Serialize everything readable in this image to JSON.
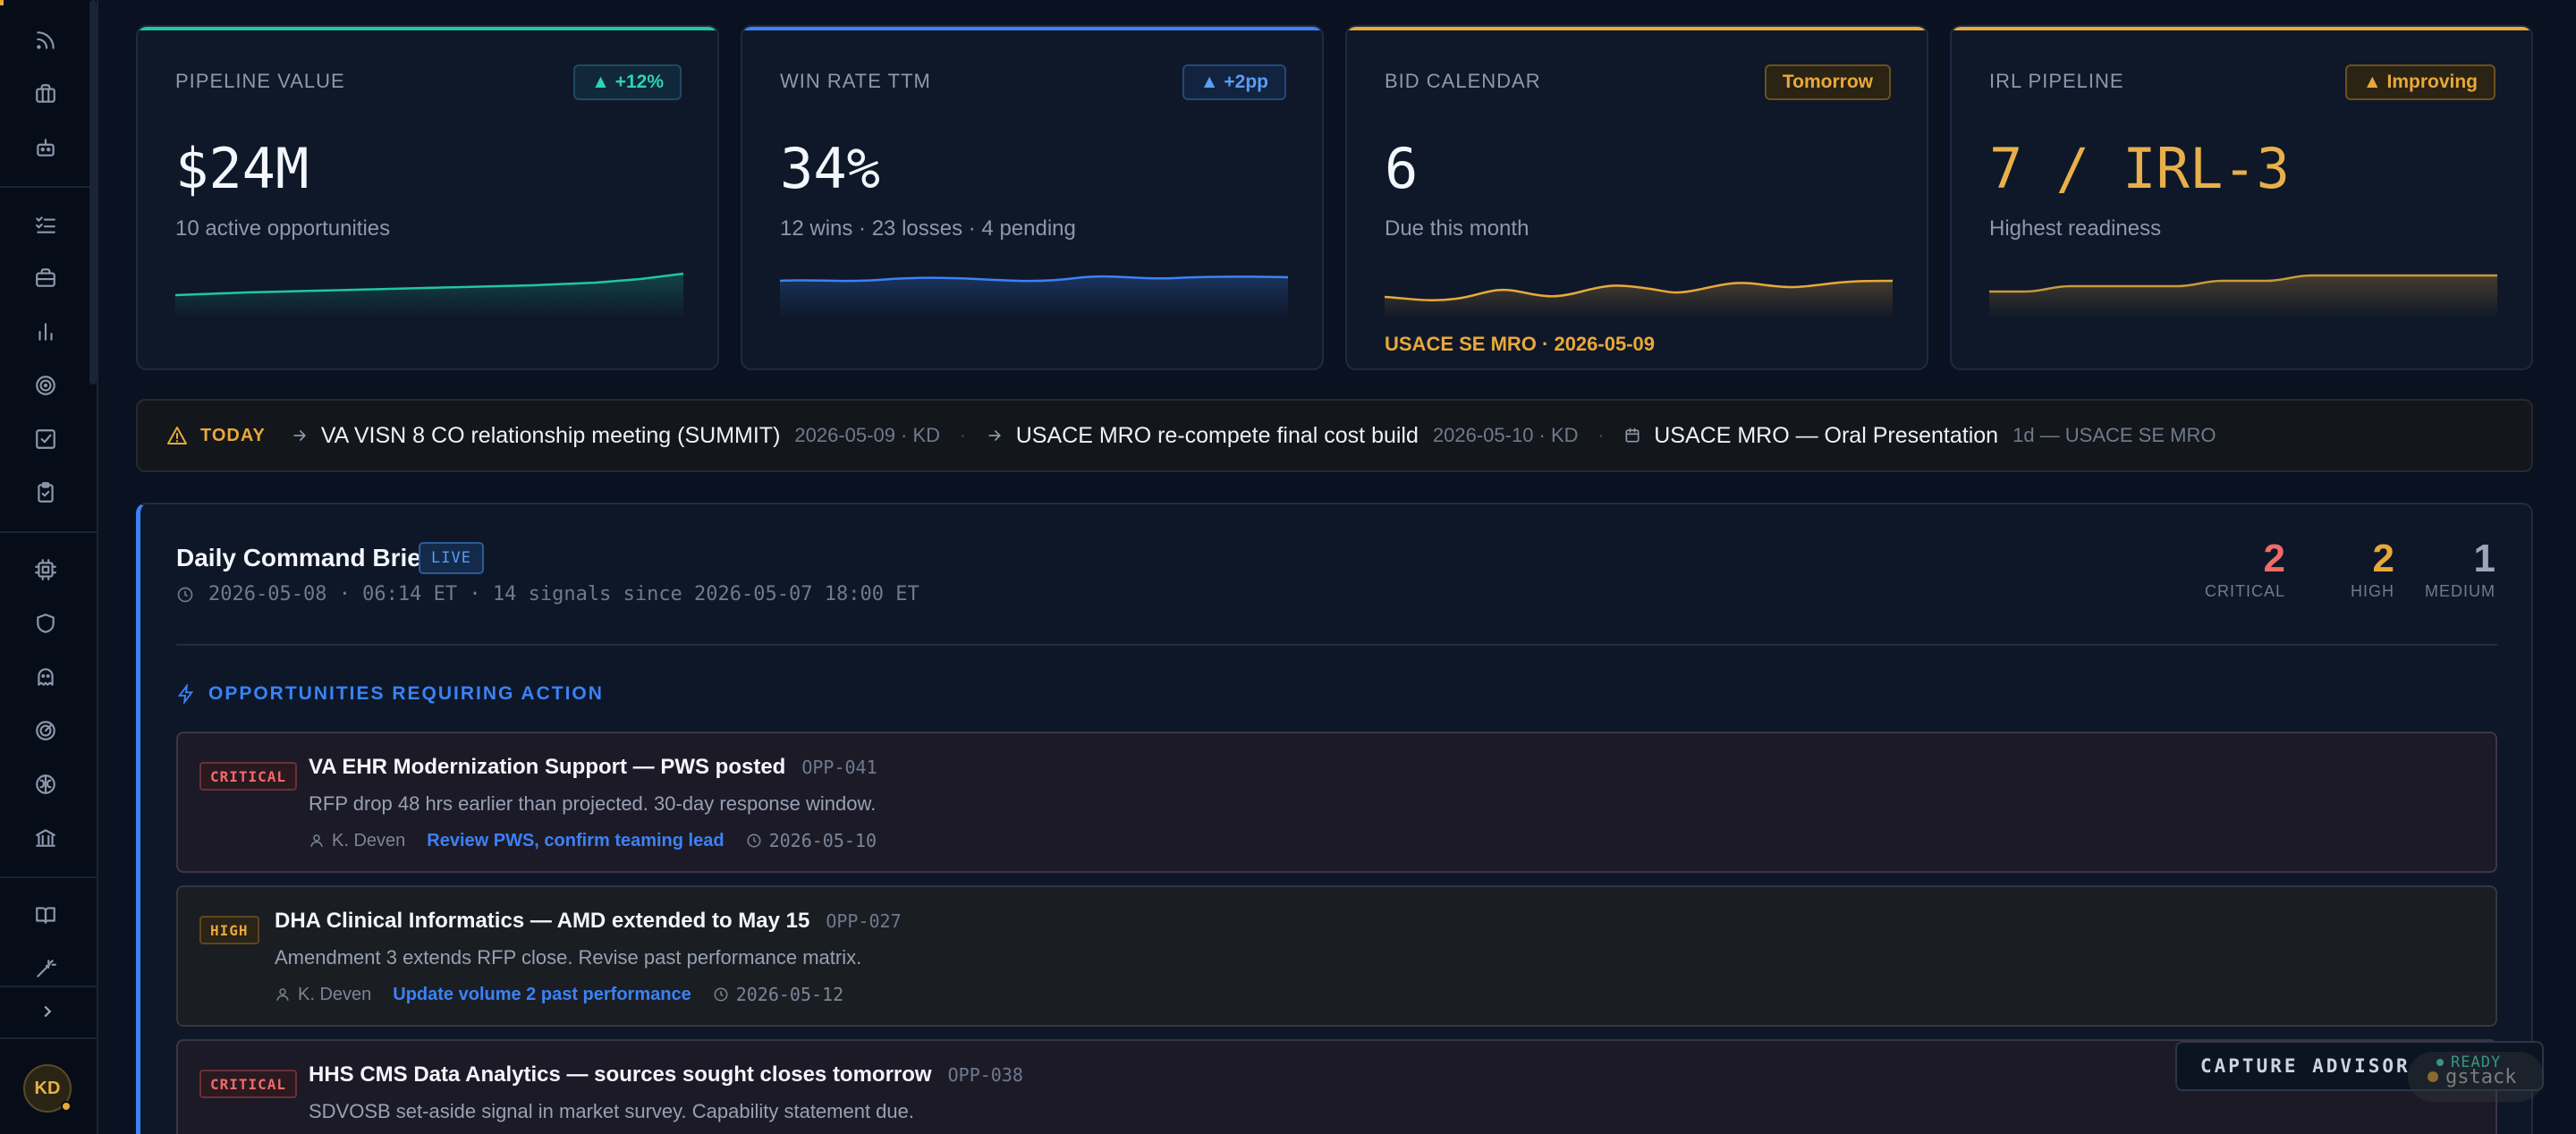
{
  "sidebar": {
    "icons": [
      "rss-icon",
      "briefcase-icon",
      "bot-icon",
      "checklist-icon",
      "briefcase-alt-icon",
      "bar-chart-icon",
      "target-icon",
      "check-square-icon",
      "clipboard-icon",
      "cpu-icon",
      "shield-icon",
      "ghost-icon",
      "radar-icon",
      "brain-icon",
      "bank-icon",
      "book-icon",
      "magic-wand-icon"
    ],
    "user_initials": "KD"
  },
  "cards": [
    {
      "label": "PIPELINE VALUE",
      "value": "$24M",
      "sub": "10 active opportunities",
      "badge": "▲ +12%",
      "accent": "#1fc7a4",
      "note": ""
    },
    {
      "label": "WIN RATE TTM",
      "value": "34%",
      "sub": "12 wins · 23 losses · 4 pending",
      "badge": "▲ +2pp",
      "accent": "#3b82f6",
      "note": ""
    },
    {
      "label": "BID CALENDAR",
      "value": "6",
      "sub": "Due this month",
      "badge": "Tomorrow",
      "accent": "#e8a93a",
      "note": "USACE SE MRO · 2026-05-09"
    },
    {
      "label": "IRL PIPELINE",
      "value": "7 / IRL-3",
      "sub": "Highest readiness",
      "badge": "▲ Improving",
      "accent": "#e8a93a",
      "note": ""
    }
  ],
  "today": {
    "label": "TODAY",
    "items": [
      {
        "title": "VA VISN 8 CO relationship meeting (SUMMIT)",
        "meta": "2026-05-09 · KD"
      },
      {
        "title": "USACE MRO re-compete final cost build",
        "meta": "2026-05-10 · KD"
      },
      {
        "title": "USACE MRO — Oral Presentation",
        "meta": "1d — USACE SE MRO"
      }
    ],
    "separator": "·"
  },
  "brief": {
    "title": "Daily Command Brief",
    "live": "LIVE",
    "meta": "2026-05-08 · 06:14 ET · 14 signals since 2026-05-07 18:00 ET",
    "counts": [
      {
        "value": "2",
        "label": "CRITICAL",
        "color": "#f26a6a"
      },
      {
        "value": "2",
        "label": "HIGH",
        "color": "#e8a93a"
      },
      {
        "value": "1",
        "label": "MEDIUM",
        "color": "#9aa6bb"
      }
    ],
    "section": "OPPORTUNITIES REQUIRING ACTION",
    "opps": [
      {
        "severity": "CRITICAL",
        "title": "VA EHR Modernization Support — PWS posted",
        "id": "OPP-041",
        "desc": "RFP drop 48 hrs earlier than projected. 30-day response window.",
        "owner": "K. Deven",
        "action": "Review PWS, confirm teaming lead",
        "due": "2026-05-10"
      },
      {
        "severity": "HIGH",
        "title": "DHA Clinical Informatics — AMD extended to May 15",
        "id": "OPP-027",
        "desc": "Amendment 3 extends RFP close. Revise past performance matrix.",
        "owner": "K. Deven",
        "action": "Update volume 2 past performance",
        "due": "2026-05-12"
      },
      {
        "severity": "CRITICAL",
        "title": "HHS CMS Data Analytics — sources sought closes tomorrow",
        "id": "OPP-038",
        "desc": "SDVOSB set-aside signal in market survey. Capability statement due.",
        "owner": "",
        "action": "",
        "due": ""
      }
    ]
  },
  "advisor": {
    "label": "CAPTURE ADVISOR",
    "status": "READY"
  },
  "gstack": "gstack"
}
